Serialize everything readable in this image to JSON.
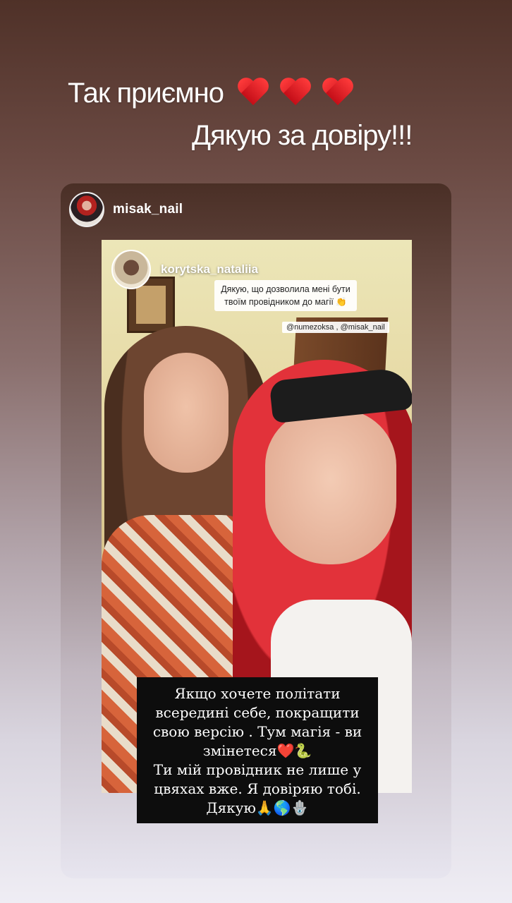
{
  "headline": {
    "line1": "Так приємно",
    "hearts": "❤️❤️❤️",
    "line2": "Дякую за довіру!!!"
  },
  "card": {
    "username": "misak_nail",
    "avatar_icon": "profile-avatar-icon"
  },
  "inner_story": {
    "username": "korytska_nataliia",
    "caption_line1": "Дякую, що дозволила мені бути",
    "caption_line2": "твоїм провідником до магії 👏",
    "mentions": "@numezoksa , @misak_nail",
    "quote_lines": [
      "Якщо хочете політати",
      "всередині себе, покращити",
      "свою версію . Тум магія - ви",
      "змінетеся❤️🐍",
      "Ти мій провідник не лише у",
      "цвяхах вже. Я довіряю тобі.",
      "Дякую🙏🌎🪬"
    ]
  },
  "colors": {
    "heart_red": "#e01b24",
    "quote_bg": "#0d0d0d"
  }
}
